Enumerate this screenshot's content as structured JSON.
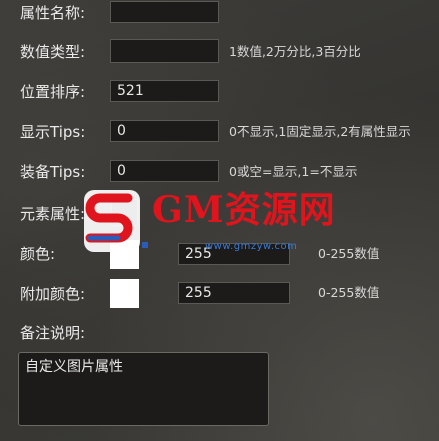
{
  "form": {
    "name": {
      "label": "属性名称:",
      "value": ""
    },
    "value_type": {
      "label": "数值类型:",
      "value": "",
      "hint": "1数值,2万分比,3百分比"
    },
    "sort": {
      "label": "位置排序:",
      "value": "521"
    },
    "show_tips": {
      "label": "显示Tips:",
      "value": "0",
      "hint": "0不显示,1固定显示,2有属性显示"
    },
    "equip_tips": {
      "label": "装备Tips:",
      "value": "0",
      "hint": "0或空=显示,1=不显示"
    },
    "element": {
      "label": "元素属性:",
      "checked": false
    },
    "color": {
      "label": "颜色:",
      "swatch": "#ffffff",
      "value": "255",
      "hint": "0-255数值"
    },
    "extra_color": {
      "label": "附加颜色:",
      "swatch": "#ffffff",
      "value": "255",
      "hint": "0-255数值"
    },
    "remark": {
      "label": "备注说明:",
      "value": "自定义图片属性"
    }
  },
  "watermark": {
    "text": "GM资源网",
    "url": "www.gmzyw.com",
    "colors": {
      "red": "#e0141c",
      "blue": "#2a5cb8"
    }
  }
}
